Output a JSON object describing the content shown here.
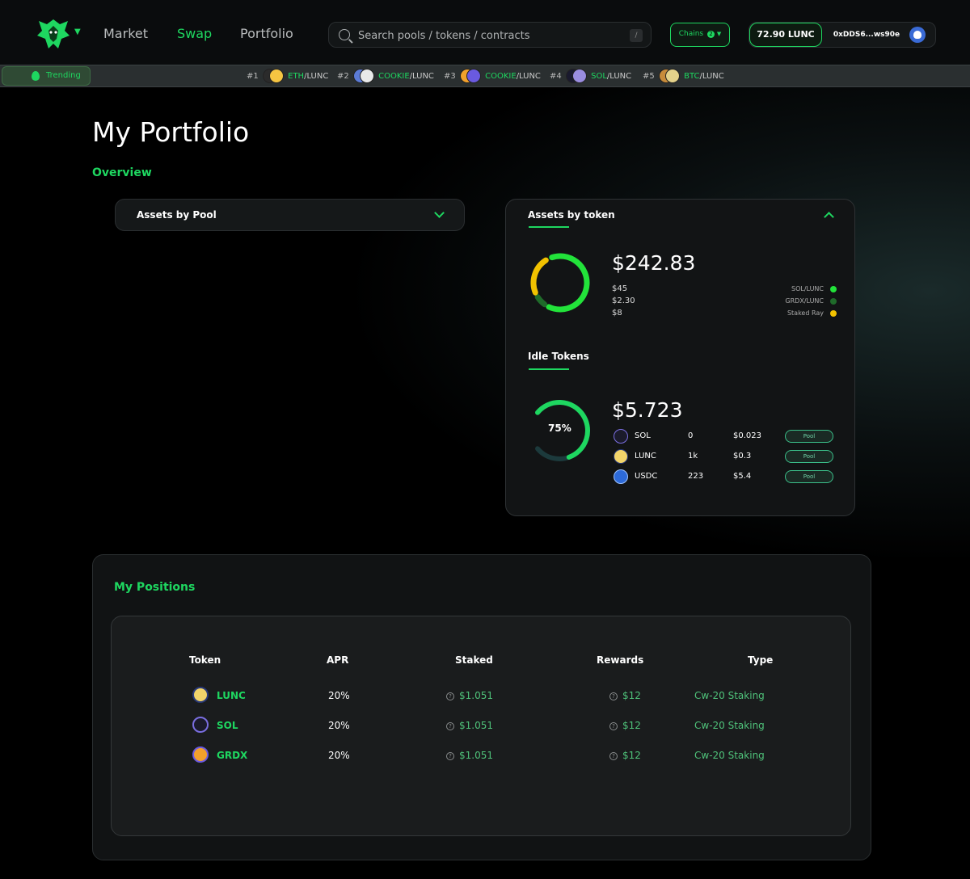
{
  "nav": {
    "links": [
      "Market",
      "Swap",
      "Portfolio"
    ],
    "active": "Swap",
    "search_placeholder": "Search pools / tokens / contracts",
    "search_shortcut": "/",
    "chains_label": "Chains",
    "chains_count": "2",
    "balance": "72.90 LUNC",
    "address": "0xDDS6...ws90e"
  },
  "trending": {
    "label": "Trending",
    "items": [
      {
        "rank": "#1",
        "symbol": "ETH",
        "pair": "/LUNC"
      },
      {
        "rank": "#2",
        "symbol": "COOKIE",
        "pair": "/LUNC"
      },
      {
        "rank": "#3",
        "symbol": "COOKIE",
        "pair": "/LUNC"
      },
      {
        "rank": "#4",
        "symbol": "SOL",
        "pair": "/LUNC"
      },
      {
        "rank": "#5",
        "symbol": "BTC",
        "pair": "/LUNC"
      }
    ]
  },
  "page": {
    "title": "My Portfolio",
    "overview": "Overview"
  },
  "assets_by_pool": {
    "label": "Assets by Pool"
  },
  "assets_by_token": {
    "label": "Assets by token",
    "total": "$242.83",
    "values": [
      "$45",
      "$2.30",
      "$8"
    ],
    "legend": [
      {
        "name": "SOL/LUNC",
        "color": "#22e33a"
      },
      {
        "name": "GRDX/LUNC",
        "color": "#1f6b2a"
      },
      {
        "name": "Staked Ray",
        "color": "#f2c200"
      }
    ],
    "donut_fractions": [
      0.62,
      0.06,
      0.22
    ]
  },
  "idle_tokens": {
    "label": "Idle Tokens",
    "total": "$5.723",
    "gauge_percent": "75%",
    "gauge_fraction": 0.75,
    "rows": [
      {
        "symbol": "SOL",
        "qty": "0",
        "price": "$0.023",
        "action": "Pool"
      },
      {
        "symbol": "LUNC",
        "qty": "1k",
        "price": "$0.3",
        "action": "Pool"
      },
      {
        "symbol": "USDC",
        "qty": "223",
        "price": "$5.4",
        "action": "Pool"
      }
    ]
  },
  "positions": {
    "title": "My Positions",
    "columns": [
      "Token",
      "APR",
      "Staked",
      "Rewards",
      "Type"
    ],
    "rows": [
      {
        "token": "LUNC",
        "apr": "20%",
        "staked": "$1.051",
        "rewards": "$12",
        "type": "Cw-20 Staking"
      },
      {
        "token": "SOL",
        "apr": "20%",
        "staked": "$1.051",
        "rewards": "$12",
        "type": "Cw-20 Staking"
      },
      {
        "token": "GRDX",
        "apr": "20%",
        "staked": "$1.051",
        "rewards": "$12",
        "type": "Cw-20 Staking"
      }
    ]
  },
  "colors": {
    "accent": "#1ed760",
    "card": "#121415"
  }
}
